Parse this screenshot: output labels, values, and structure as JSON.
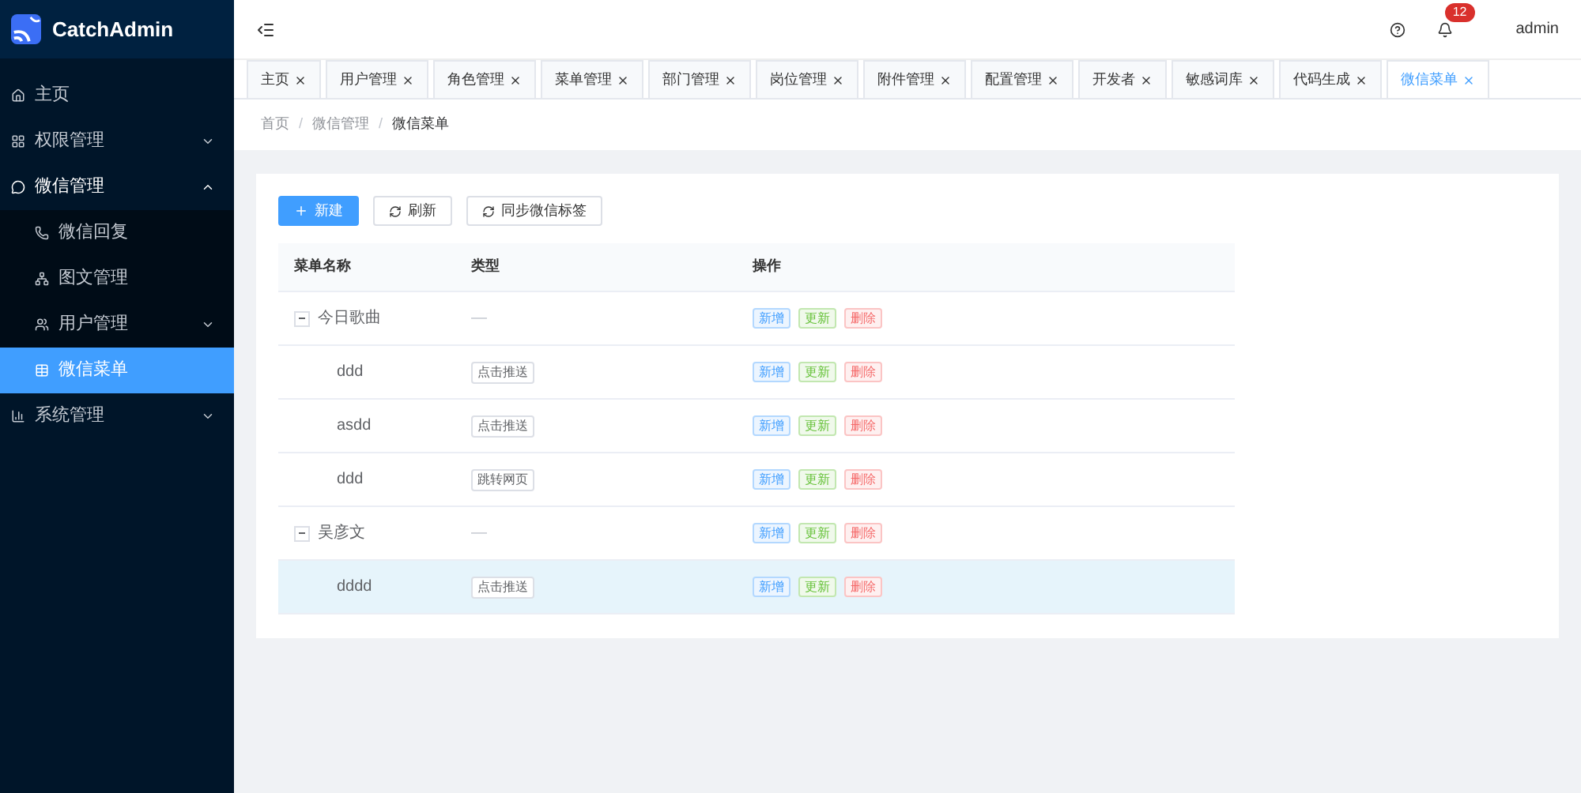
{
  "app": {
    "name": "CatchAdmin"
  },
  "sidebar": {
    "items": [
      {
        "label": "主页",
        "expandable": false,
        "expanded": false,
        "selected": false
      },
      {
        "label": "权限管理",
        "expandable": true,
        "expanded": false,
        "selected": false
      },
      {
        "label": "微信管理",
        "expandable": true,
        "expanded": true,
        "selected": false,
        "children": [
          {
            "label": "微信回复",
            "expandable": false,
            "expanded": false,
            "selected": false
          },
          {
            "label": "图文管理",
            "expandable": false,
            "expanded": false,
            "selected": false
          },
          {
            "label": "用户管理",
            "expandable": true,
            "expanded": false,
            "selected": false
          },
          {
            "label": "微信菜单",
            "expandable": false,
            "expanded": false,
            "selected": true
          }
        ]
      },
      {
        "label": "系统管理",
        "expandable": true,
        "expanded": false,
        "selected": false
      }
    ]
  },
  "header": {
    "notification_count": "12",
    "user": "admin"
  },
  "tabs": [
    {
      "label": "主页",
      "selected": false
    },
    {
      "label": "用户管理",
      "selected": false
    },
    {
      "label": "角色管理",
      "selected": false
    },
    {
      "label": "菜单管理",
      "selected": false
    },
    {
      "label": "部门管理",
      "selected": false
    },
    {
      "label": "岗位管理",
      "selected": false
    },
    {
      "label": "附件管理",
      "selected": false
    },
    {
      "label": "配置管理",
      "selected": false
    },
    {
      "label": "开发者",
      "selected": false
    },
    {
      "label": "敏感词库",
      "selected": false
    },
    {
      "label": "代码生成",
      "selected": false
    },
    {
      "label": "微信菜单",
      "selected": true
    }
  ],
  "breadcrumb": [
    "首页",
    "微信管理",
    "微信菜单"
  ],
  "breadcrumb_separator": "/",
  "toolbar": [
    {
      "label": "新建",
      "kind": "primary"
    },
    {
      "label": "刷新",
      "kind": "refresh"
    },
    {
      "label": "同步微信标签",
      "kind": "refresh"
    }
  ],
  "table": {
    "columns": [
      "菜单名称",
      "类型",
      "操作"
    ],
    "rows": [
      {
        "name": "今日歌曲",
        "type": "—",
        "expanded": true,
        "selected": false,
        "actions": [
          "新增",
          "更新",
          "删除"
        ],
        "children": [
          {
            "name": "ddd",
            "type": "点击推送",
            "selected": false,
            "actions": [
              "新增",
              "更新",
              "删除"
            ]
          },
          {
            "name": "asdd",
            "type": "点击推送",
            "selected": false,
            "actions": [
              "新增",
              "更新",
              "删除"
            ]
          },
          {
            "name": "ddd",
            "type": "跳转网页",
            "selected": false,
            "actions": [
              "新增",
              "更新",
              "删除"
            ]
          }
        ]
      },
      {
        "name": "吴彦文",
        "type": "—",
        "expanded": true,
        "selected": false,
        "actions": [
          "新增",
          "更新",
          "删除"
        ],
        "children": [
          {
            "name": "dddd",
            "type": "点击推送",
            "selected": true,
            "actions": [
              "新增",
              "更新",
              "删除"
            ]
          }
        ]
      }
    ]
  }
}
